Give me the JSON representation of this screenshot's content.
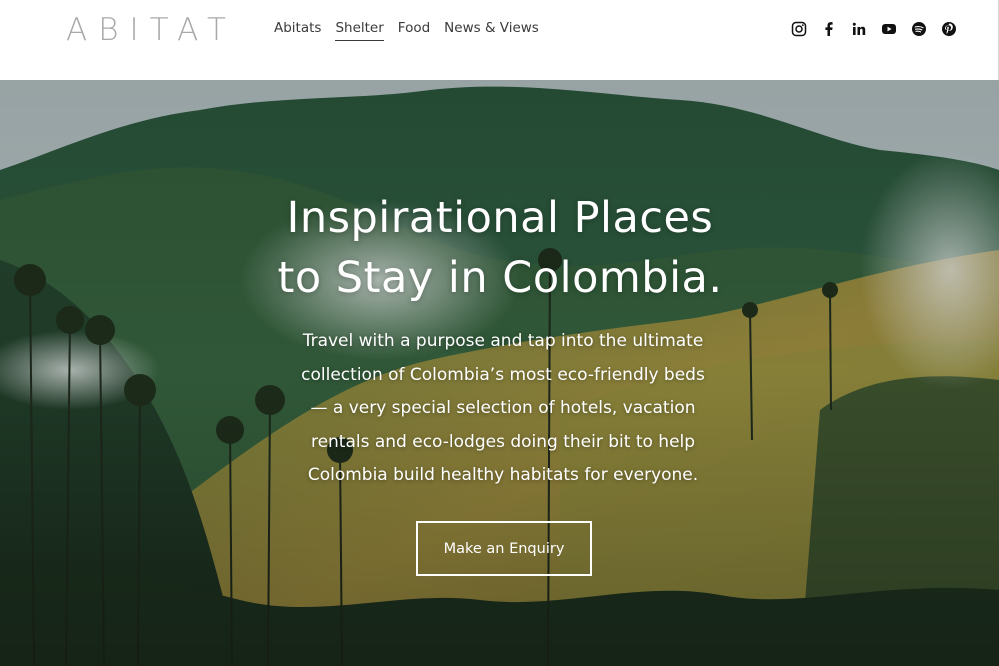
{
  "header": {
    "logo": "ABITAT",
    "nav": [
      {
        "label": "Abitats",
        "active": false
      },
      {
        "label": "Shelter",
        "active": true
      },
      {
        "label": "Food",
        "active": false
      },
      {
        "label": "News & Views",
        "active": false
      }
    ],
    "social": [
      "instagram-icon",
      "facebook-icon",
      "linkedin-icon",
      "youtube-icon",
      "spotify-icon",
      "pinterest-icon"
    ]
  },
  "hero": {
    "title_lines": [
      "Inspirational Places",
      "to Stay in Colombia."
    ],
    "body_lines": [
      "Travel with a purpose and tap into the ultimate",
      "collection of Colombia’s most eco-friendly beds",
      "— a very special selection of hotels, vacation",
      "rentals and eco-lodges doing their bit to help",
      "Colombia build healthy habitats for everyone."
    ],
    "cta_label": "Make an Enquiry"
  },
  "colors": {
    "header_bg": "#ffffff",
    "nav_text": "#3a3a3a",
    "logo": "#a9a9a9",
    "hero_text": "#ffffff"
  }
}
